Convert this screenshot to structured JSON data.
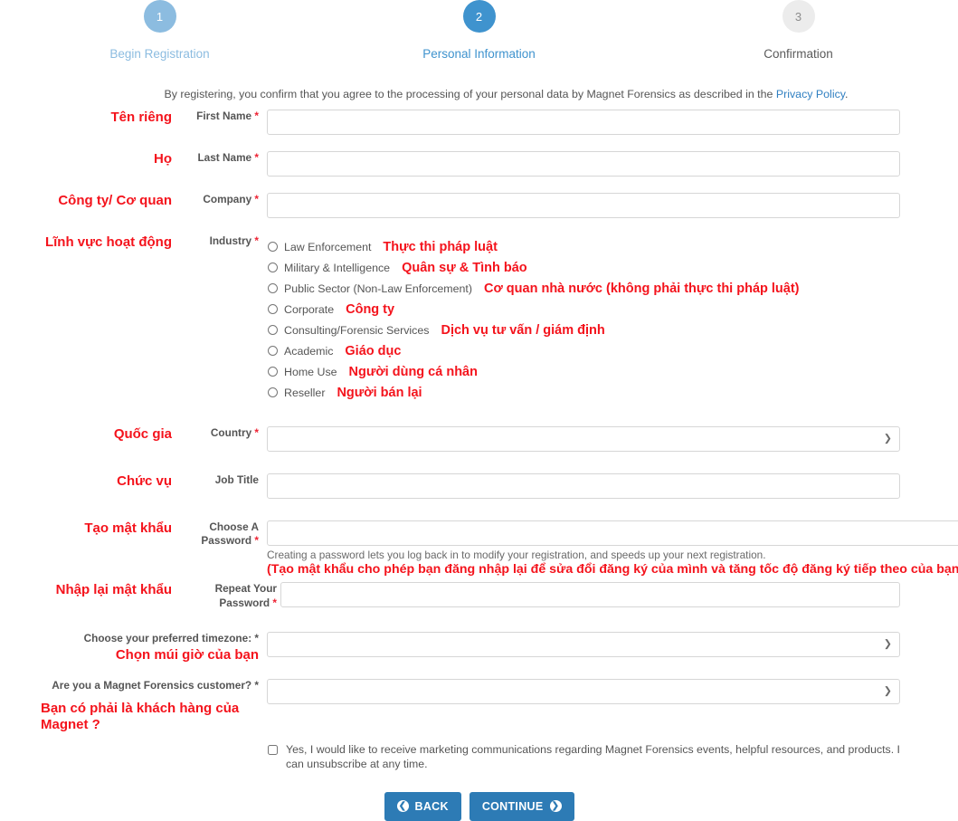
{
  "stepper": {
    "steps": [
      {
        "number": "1",
        "label": "Begin Registration"
      },
      {
        "number": "2",
        "label": "Personal Information"
      },
      {
        "number": "3",
        "label": "Confirmation"
      }
    ]
  },
  "consent": {
    "text_before": "By registering, you confirm that you agree to the processing of your personal data by Magnet Forensics as described in the ",
    "link_text": "Privacy Policy",
    "text_after": "."
  },
  "fields": {
    "first_name": {
      "vn": "Tên riêng",
      "en": "First Name",
      "required": "*",
      "value": ""
    },
    "last_name": {
      "vn": "Họ",
      "en": "Last Name",
      "required": "*",
      "value": ""
    },
    "company": {
      "vn": "Công ty/ Cơ quan",
      "en": "Company",
      "required": "*",
      "value": ""
    },
    "industry": {
      "vn": "Lĩnh vực hoạt động",
      "en": "Industry",
      "required": "*"
    },
    "country": {
      "vn": "Quốc gia",
      "en": "Country",
      "required": "*",
      "value": ""
    },
    "job_title": {
      "vn": "Chức vụ",
      "en": "Job Title",
      "required": "",
      "value": ""
    },
    "password": {
      "vn": "Tạo mật khẩu",
      "en": "Choose A Password",
      "required": "*",
      "value": "",
      "help_en": "Creating a password lets you log back in to modify your registration, and speeds up your next registration.",
      "help_vn": "(Tạo mật khẩu cho phép bạn đăng nhập lại để sửa đổi đăng ký của mình và tăng tốc độ đăng ký tiếp theo của bạn)"
    },
    "repeat_password": {
      "vn": "Nhập lại mật khẩu",
      "en": "Repeat Your Password",
      "required": "*",
      "value": ""
    },
    "timezone": {
      "vn": "Chọn múi giờ của bạn",
      "en": "Choose your preferred timezone:",
      "required": "*",
      "value": ""
    },
    "customer": {
      "vn": "Bạn có phải là khách hàng của Magnet ?",
      "en": "Are you a Magnet Forensics customer?",
      "required": "*",
      "value": ""
    }
  },
  "industry_options": [
    {
      "en": "Law Enforcement",
      "vn": "Thực thi pháp luật",
      "checked": false
    },
    {
      "en": "Military & Intelligence",
      "vn": "Quân sự & Tình báo",
      "checked": false
    },
    {
      "en": "Public Sector (Non-Law Enforcement)",
      "vn": "Cơ quan nhà nước (không phải thực thi pháp luật)",
      "checked": false
    },
    {
      "en": "Corporate",
      "vn": "Công ty",
      "checked": false
    },
    {
      "en": "Consulting/Forensic Services",
      "vn": "Dịch vụ tư vấn / giám định",
      "checked": false
    },
    {
      "en": "Academic",
      "vn": "Giáo dục",
      "checked": false
    },
    {
      "en": "Home Use",
      "vn": "Người dùng cá nhân",
      "checked": false
    },
    {
      "en": "Reseller",
      "vn": "Người bán lại",
      "checked": false
    }
  ],
  "marketing_optin": {
    "text": "Yes, I would like to receive marketing communications regarding Magnet Forensics events, helpful resources, and products. I can unsubscribe at any time.",
    "checked": false
  },
  "buttons": {
    "back": "BACK",
    "continue": "CONTINUE",
    "back_icon": "arrow-left-circle-icon",
    "continue_icon": "arrow-right-circle-icon"
  },
  "colors": {
    "annotation_red": "#F4131C",
    "step_active": "#3F93CE",
    "step_done": "#8CBCE0",
    "step_inactive": "#ECECEC",
    "button_blue": "#2D7BB5",
    "link_blue": "#2f7fc1"
  }
}
